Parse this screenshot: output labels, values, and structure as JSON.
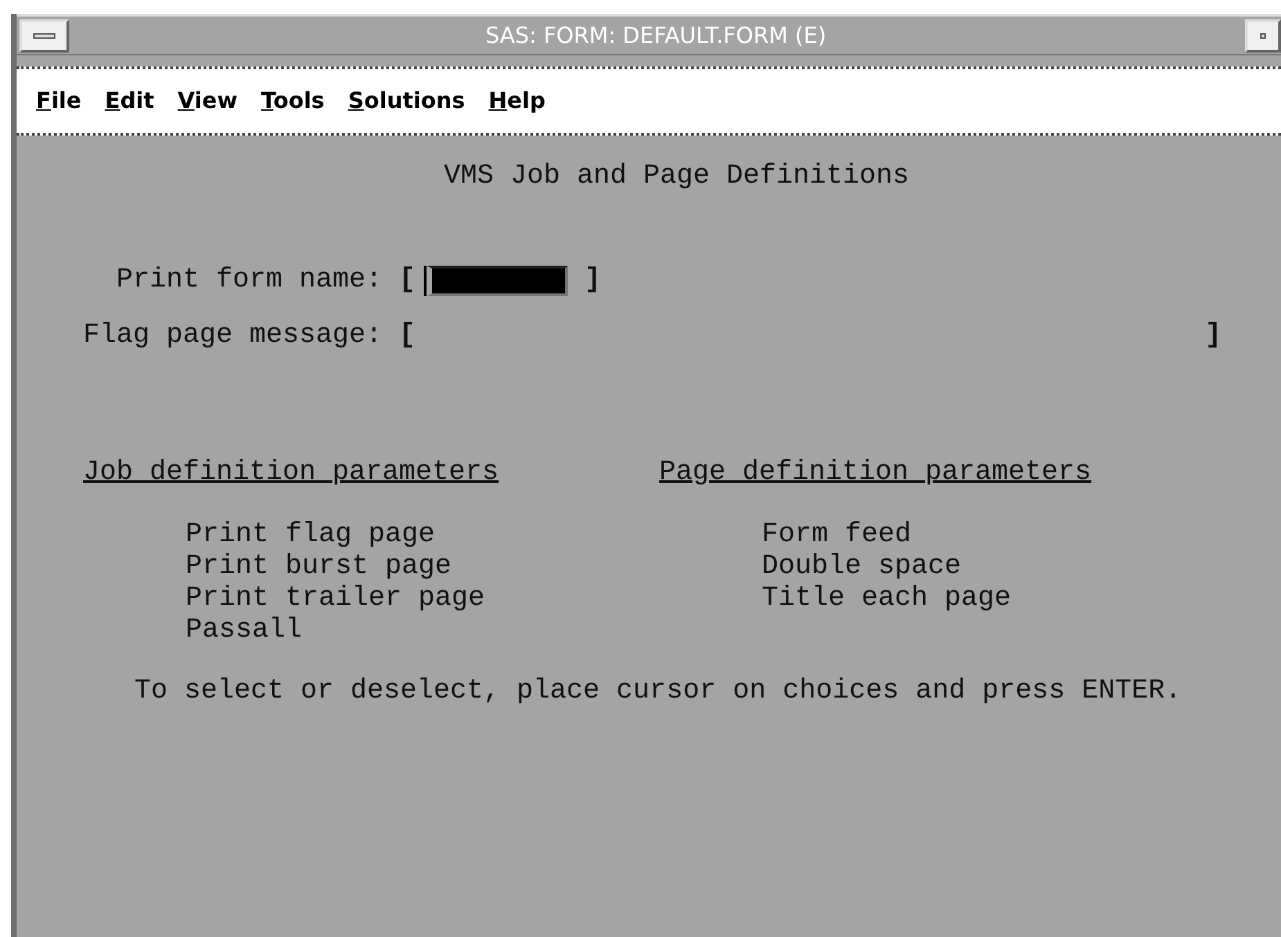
{
  "window": {
    "title": "SAS: FORM:  DEFAULT.FORM (E)"
  },
  "menu": [
    "File",
    "Edit",
    "View",
    "Tools",
    "Solutions",
    "Help"
  ],
  "form": {
    "heading": "VMS Job and Page Definitions",
    "fields": [
      {
        "label": "Print form name:",
        "open": "[",
        "close": "]",
        "kind": "short"
      },
      {
        "label": "Flag page message:",
        "open": "[",
        "close": "]",
        "kind": "long"
      }
    ],
    "groups": [
      {
        "title": "Job definition parameters",
        "options": [
          "Print flag page",
          "Print burst page",
          "Print trailer page",
          "Passall"
        ]
      },
      {
        "title": "Page definition parameters",
        "options": [
          "Form feed",
          "Double space",
          "Title each page"
        ]
      }
    ],
    "instruction": "To select or deselect, place cursor on choices and press ENTER."
  }
}
